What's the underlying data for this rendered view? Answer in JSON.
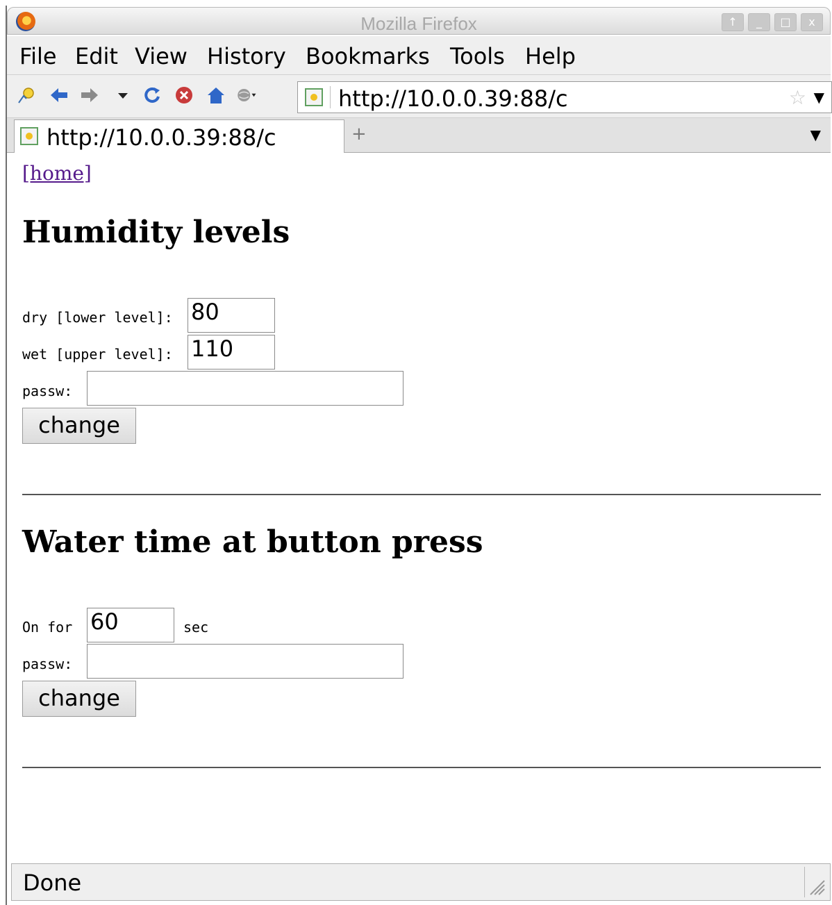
{
  "window": {
    "title": "Mozilla Firefox",
    "controls": [
      "↑",
      "_",
      "□",
      "x"
    ]
  },
  "menu": [
    "File",
    "Edit",
    "View",
    "History",
    "Bookmarks",
    "Tools",
    "Help"
  ],
  "toolbar": {
    "url": "http://10.0.0.39:88/c",
    "icons": [
      "bookmark-icon",
      "back-icon",
      "forward-icon",
      "history-dropdown-icon",
      "reload-icon",
      "stop-icon",
      "home-icon",
      "globe-icon"
    ]
  },
  "tab": {
    "title": "http://10.0.0.39:88/c",
    "new_tab": "+"
  },
  "page": {
    "home_link": "[home]",
    "humidity": {
      "heading": "Humidity levels",
      "dry_label": "dry [lower level]:",
      "dry_value": "80",
      "wet_label": "wet [upper level]:",
      "wet_value": "110",
      "passw_label": "passw:",
      "passw_value": "",
      "button": "change"
    },
    "water": {
      "heading": "Water time at button press",
      "on_label": "On for",
      "on_value": "60",
      "unit": "sec",
      "passw_label": "passw:",
      "passw_value": "",
      "button": "change"
    }
  },
  "status": {
    "text": "Done"
  }
}
